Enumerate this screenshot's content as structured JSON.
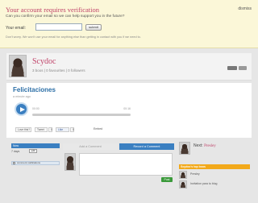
{
  "verification": {
    "title": "Your account requires verification",
    "dismiss": "dismiss",
    "subtitle": "Can you confirm your email so we can help support you in the future?",
    "email_label": "Your email:",
    "email_value": "",
    "submit_label": "submit",
    "note": "Don't worry. We won't use your email for anything else than getting in contact with you if we need to."
  },
  "profile": {
    "name": "Scydoc",
    "stats": "3 boos | 0 favourites | 0 followers"
  },
  "post": {
    "title": "Felicitaciones",
    "date": "a minute ago",
    "time_start": "00:00",
    "time_end": "00:16",
    "love_label": "Love this?",
    "tweet_label": "Tweet",
    "tweet_count": "0",
    "like_label": "Like",
    "like_count": "0",
    "embed_label": "Embed"
  },
  "sidebar_left": {
    "tab_label": "Now",
    "days": "7 days",
    "edit_label": "edit",
    "notifications_label": "comment notifications"
  },
  "comments": {
    "tab_add": "Add a Comment",
    "tab_record": "Record a Comment",
    "post_label": "Post"
  },
  "sidebar_right": {
    "next_label": "Next:",
    "next_name": "Presley",
    "top_boos_label": "Scydoc's top boos",
    "items": [
      "Presley",
      "Invitation para tu blog"
    ]
  },
  "colors": {
    "brand_pink": "#c0446a",
    "blue": "#3a7fc1",
    "orange": "#f2a91a",
    "green": "#3a9a3a"
  }
}
